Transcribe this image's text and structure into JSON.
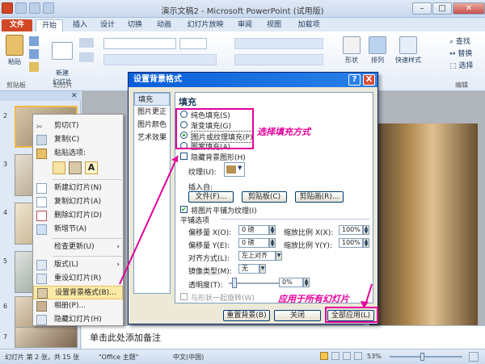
{
  "window": {
    "title": "演示文稿2 - Microsoft PowerPoint (试用版)"
  },
  "tabs": [
    "文件",
    "开始",
    "插入",
    "设计",
    "切换",
    "动画",
    "幻灯片放映",
    "审阅",
    "视图",
    "加载项"
  ],
  "ribbon": {
    "paste": "粘贴",
    "new_slide": "新建\n幻灯片",
    "group_clipboard": "剪贴板",
    "group_slides": "幻灯片",
    "shape": "形状",
    "arrange": "排列",
    "quick_styles": "快速样式",
    "find": "查找",
    "replace": "替换",
    "select": "选择",
    "group_edit": "编辑"
  },
  "thumbnails": [
    {
      "num": "2"
    },
    {
      "num": "3"
    },
    {
      "num": "4"
    },
    {
      "num": "5"
    },
    {
      "num": "6"
    },
    {
      "num": "7"
    }
  ],
  "context_menu": {
    "cut": "剪切(T)",
    "copy": "复制(C)",
    "paste_options": "粘贴选项:",
    "new_slide": "新建幻灯片(N)",
    "duplicate": "复制幻灯片(A)",
    "delete": "删除幻灯片(D)",
    "add_section": "新增节(A)",
    "check_updates": "检查更新(U)",
    "layout": "版式(L)",
    "reset": "重设幻灯片(R)",
    "format_bg": "设置背景格式(B)...",
    "photo_album": "相册(P)...",
    "hide_slide": "隐藏幻灯片(H)"
  },
  "dialog": {
    "title": "设置背景格式",
    "help": "?",
    "close": "X",
    "nav": [
      "填充",
      "图片更正",
      "图片颜色",
      "艺术效果"
    ],
    "section": "填充",
    "options": [
      "纯色填充(S)",
      "渐变填充(G)",
      "图片或纹理填充(P)",
      "图案填充(A)"
    ],
    "hide_bg": "隐藏背景图形(H)",
    "texture": "纹理(U):",
    "insert_from": "插入自:",
    "btn_file": "文件(F)...",
    "btn_clipboard": "剪贴板(C)",
    "btn_clipart": "剪贴画(R)...",
    "tile": "将图片平铺为纹理(I)",
    "tile_options": "平铺选项",
    "offset_x": "偏移量 X(O):",
    "offset_x_val": "0 磅",
    "offset_y": "偏移量 Y(E):",
    "offset_y_val": "0 磅",
    "scale_x": "缩放比例 X(X):",
    "scale_x_val": "100%",
    "scale_y": "缩放比例 Y(Y):",
    "scale_y_val": "100%",
    "align": "对齐方式(L):",
    "align_val": "左上对齐",
    "mirror": "镜像类型(M):",
    "mirror_val": "无",
    "transparency": "透明度(T):",
    "transparency_val": "0%",
    "rotate": "与形状一起旋转(W)",
    "btn_reset": "重置背景(B)",
    "btn_close": "关闭",
    "btn_apply_all": "全部应用(L)"
  },
  "annotations": {
    "choose_fill": "选择填充方式",
    "apply_all": "应用于所有幻灯片"
  },
  "notes": "单击此处添加备注",
  "status": {
    "slide_info": "幻灯片 第 2 张，共 15 张",
    "theme": "\"Office 主题\"",
    "language": "中文(中国)",
    "zoom": "53%"
  },
  "colors": {
    "highlight": "#e4009a",
    "file_tab": "#d24726",
    "dialog_title": "#0a5fd8"
  }
}
